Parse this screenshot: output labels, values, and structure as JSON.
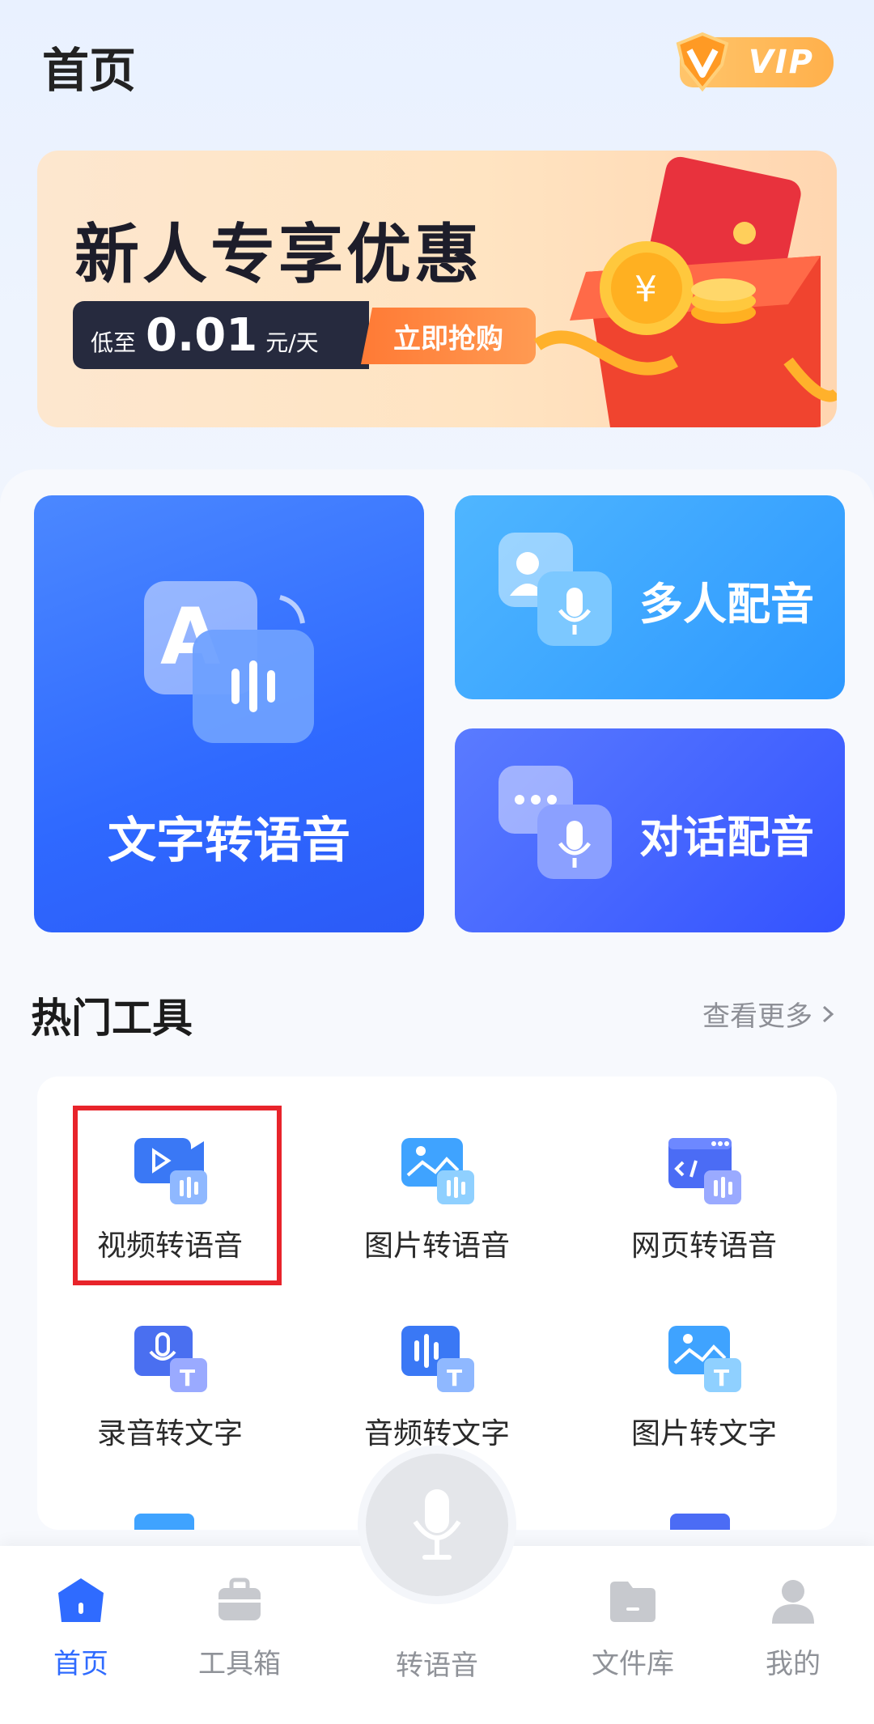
{
  "header": {
    "title": "首页",
    "vip_label": "VIP"
  },
  "banner": {
    "title": "新人专享优惠",
    "price_prefix": "低至",
    "price": "0.01",
    "price_unit": "元/天",
    "cta": "立即抢购"
  },
  "features": {
    "text_to_speech": "文字转语音",
    "multi_dub": "多人配音",
    "dialog_dub": "对话配音"
  },
  "hot_tools": {
    "title": "热门工具",
    "see_more": "查看更多",
    "items": [
      {
        "label": "视频转语音",
        "icon": "video-to-audio-icon"
      },
      {
        "label": "图片转语音",
        "icon": "image-to-audio-icon"
      },
      {
        "label": "网页转语音",
        "icon": "webpage-to-audio-icon"
      },
      {
        "label": "录音转文字",
        "icon": "recording-to-text-icon"
      },
      {
        "label": "音频转文字",
        "icon": "audio-to-text-icon"
      },
      {
        "label": "图片转文字",
        "icon": "image-to-text-icon"
      }
    ]
  },
  "bottom_nav": {
    "home": "首页",
    "toolbox": "工具箱",
    "to_speech": "转语音",
    "files": "文件库",
    "mine": "我的"
  },
  "colors": {
    "accent": "#2f6bff",
    "highlight": "#e8242b",
    "cta": "#ff7a35"
  }
}
